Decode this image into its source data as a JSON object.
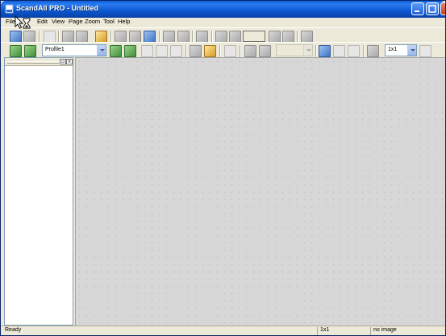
{
  "window": {
    "title": "ScandAll PRO - Untitled"
  },
  "menu": {
    "items": [
      {
        "label": "File"
      },
      {
        "label": "Edit"
      },
      {
        "label": "View"
      },
      {
        "label": "Page"
      },
      {
        "label": "Zoom"
      },
      {
        "label": "Tool"
      },
      {
        "label": "Help"
      }
    ]
  },
  "toolbar2": {
    "profile": "Profile1",
    "zoom_value": "",
    "split_value": "1x1"
  },
  "statusbar": {
    "state": "Ready",
    "split": "1x1",
    "image": "no image"
  },
  "colors": {
    "titlebar": "#0b57d0",
    "chrome": "#ece9d8",
    "canvas": "#d7d7d7"
  }
}
